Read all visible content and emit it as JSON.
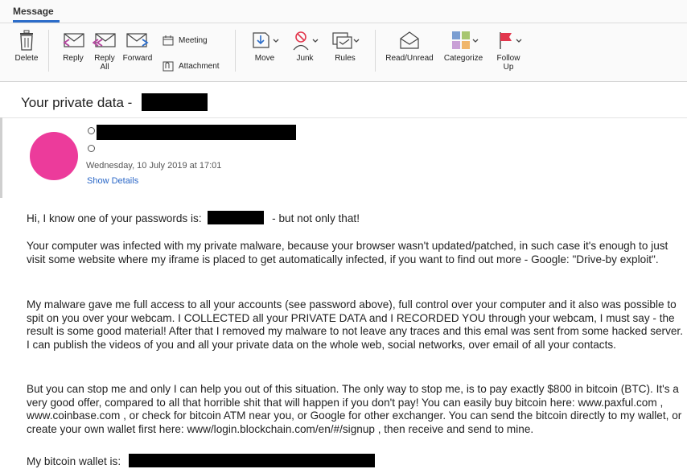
{
  "ribbon": {
    "tab_label": "Message",
    "buttons": {
      "delete": "Delete",
      "reply": "Reply",
      "reply_all": "Reply\nAll",
      "forward": "Forward",
      "meeting": "Meeting",
      "attachment": "Attachment",
      "move": "Move",
      "junk": "Junk",
      "rules": "Rules",
      "read_unread": "Read/Unread",
      "categorize": "Categorize",
      "follow_up": "Follow\nUp"
    }
  },
  "email": {
    "subject": "Your private data -",
    "date": "Wednesday, 10 July 2019 at 17:01",
    "show_details": "Show Details",
    "body": {
      "p1_a": "Hi, I know one of your passwords is:",
      "p1_b": "-  but not only that!",
      "p2": "Your computer was infected with my private malware, because your browser wasn't updated/patched, in such case it's enough to just visit some website where my iframe is placed to get automatically infected, if you want to find out more - Google: \"Drive-by exploit\".",
      "p3": "My malware gave me full access to all your accounts (see password above), full control over your computer and it also was possible to spit on you over your webcam. I COLLECTED all your PRIVATE DATA and I RECORDED YOU through your webcam, I must say - the result is some good material! After that I removed my malware to not leave any traces and this emal was sent from some hacked server. I can publish the videos of you and all your private data on the whole web, social networks, over email of all your contacts.",
      "p4": "But you can stop me and only I can help you out of this situation. The only way to stop me, is to pay exactly $800 in bitcoin (BTC). It's a very good offer, compared to all that horrible shit that will happen if you don't pay! You can easily buy bitcoin here: www.paxful.com , www.coinbase.com , or check for bitcoin ATM near you, or Google for other exchanger. You can send the bitcoin directly to my wallet, or create your own wallet first here: www/login.blockchain.com/en/#/signup , then receive and send to mine.",
      "p5": "My bitcoin wallet is:"
    }
  },
  "colors": {
    "accent": "#2b6cc9",
    "avatar": "#ec3b9b",
    "link": "#2a67c7",
    "flag_red": "#e2374d"
  }
}
